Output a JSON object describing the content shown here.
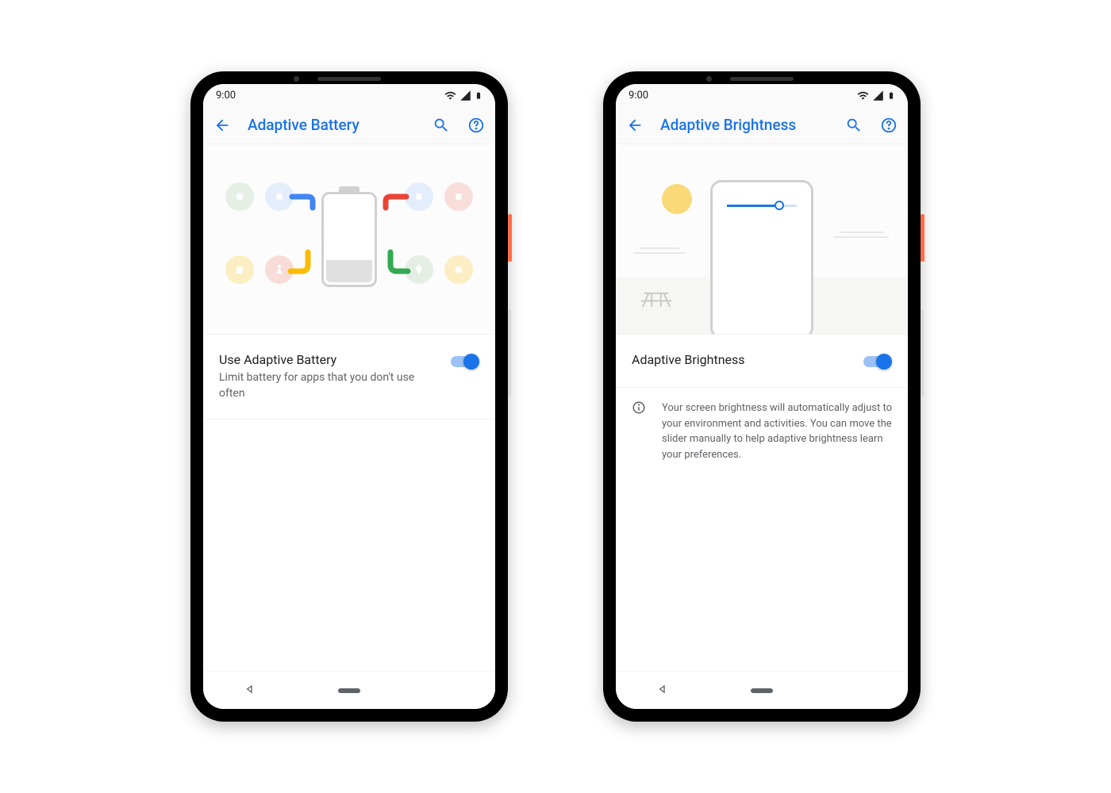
{
  "status": {
    "time": "9:00"
  },
  "colors": {
    "accent": "#1a73e8"
  },
  "left": {
    "title": "Adaptive Battery",
    "setting_title": "Use Adaptive Battery",
    "setting_sub": "Limit battery for apps that you don't use often",
    "toggle_on": true
  },
  "right": {
    "title": "Adaptive Brightness",
    "setting_title": "Adaptive Brightness",
    "info_text": "Your screen brightness will automatically adjust to your environment and activities. You can move the slider manually to help adaptive brightness learn your preferences.",
    "toggle_on": true
  }
}
